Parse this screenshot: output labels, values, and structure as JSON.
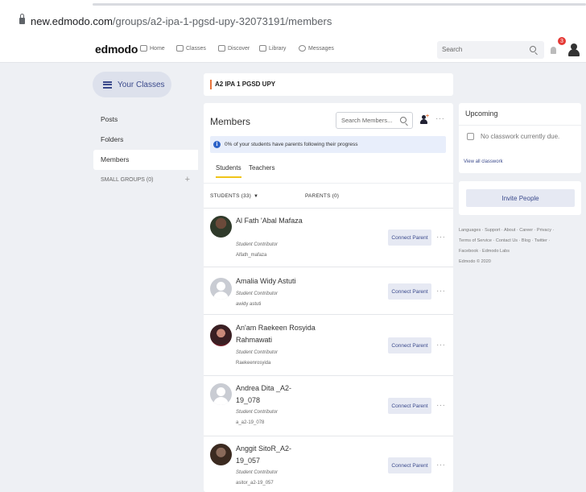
{
  "browser": {
    "url_host": "new.edmodo.com",
    "url_path": "/groups/a2-ipa-1-pgsd-upy-32073191/members"
  },
  "nav": {
    "logo": "edmodo",
    "items": [
      "Home",
      "Classes",
      "Discover",
      "Library",
      "Messages"
    ],
    "search_placeholder": "Search",
    "notification_count": "3"
  },
  "sidebar": {
    "your_classes": "Your Classes",
    "items": [
      "Posts",
      "Folders",
      "Members"
    ],
    "small_groups": "SMALL GROUPS (0)",
    "add": "+"
  },
  "class_name": "A2 IPA 1 PGSD UPY",
  "members": {
    "title": "Members",
    "search_placeholder": "Search Members...",
    "info": "0% of your students have parents following their progress",
    "tabs": [
      "Students",
      "Teachers"
    ],
    "students_header": "STUDENTS (33)",
    "parents_header": "PARENTS (0)",
    "connect_label": "Connect Parent",
    "rows": [
      {
        "name": "Al Fath 'Abal Mafaza",
        "role": "Student Contributor",
        "username": "Alfath_mafaza",
        "avatar": "photo"
      },
      {
        "name": "Amalia Widy Astuti",
        "role": "Student Contributor",
        "username": "awidy astuti",
        "avatar": "default"
      },
      {
        "name": "An'am Raekeen Rosyida Rahmawati",
        "role": "Student Contributor",
        "username": "Raekeenrosyida",
        "avatar": "photo"
      },
      {
        "name": "Andrea Dita _A2-19_078",
        "role": "Student Contributor",
        "username": "a_a2-19_078",
        "avatar": "default"
      },
      {
        "name": "Anggit SitoR_A2-19_057",
        "role": "Student Contributor",
        "username": "asitor_a2-19_057",
        "avatar": "photo"
      }
    ]
  },
  "upcoming": {
    "title": "Upcoming",
    "empty": "No classwork currently due.",
    "view_all": "View all classwork"
  },
  "invite_label": "Invite People",
  "footer": {
    "line1": "Languages · Support · About · Career · Privacy ·",
    "line2": "Terms of Service · Contact Us · Blog · Twitter ·",
    "line3": "Facebook · Edmodo Labs",
    "line4": "Edmodo © 2020"
  },
  "colors": {
    "accent": "#3b4a8c",
    "tab_underline": "#f0c419",
    "class_accent": "#e8743b",
    "badge": "#e53935"
  }
}
